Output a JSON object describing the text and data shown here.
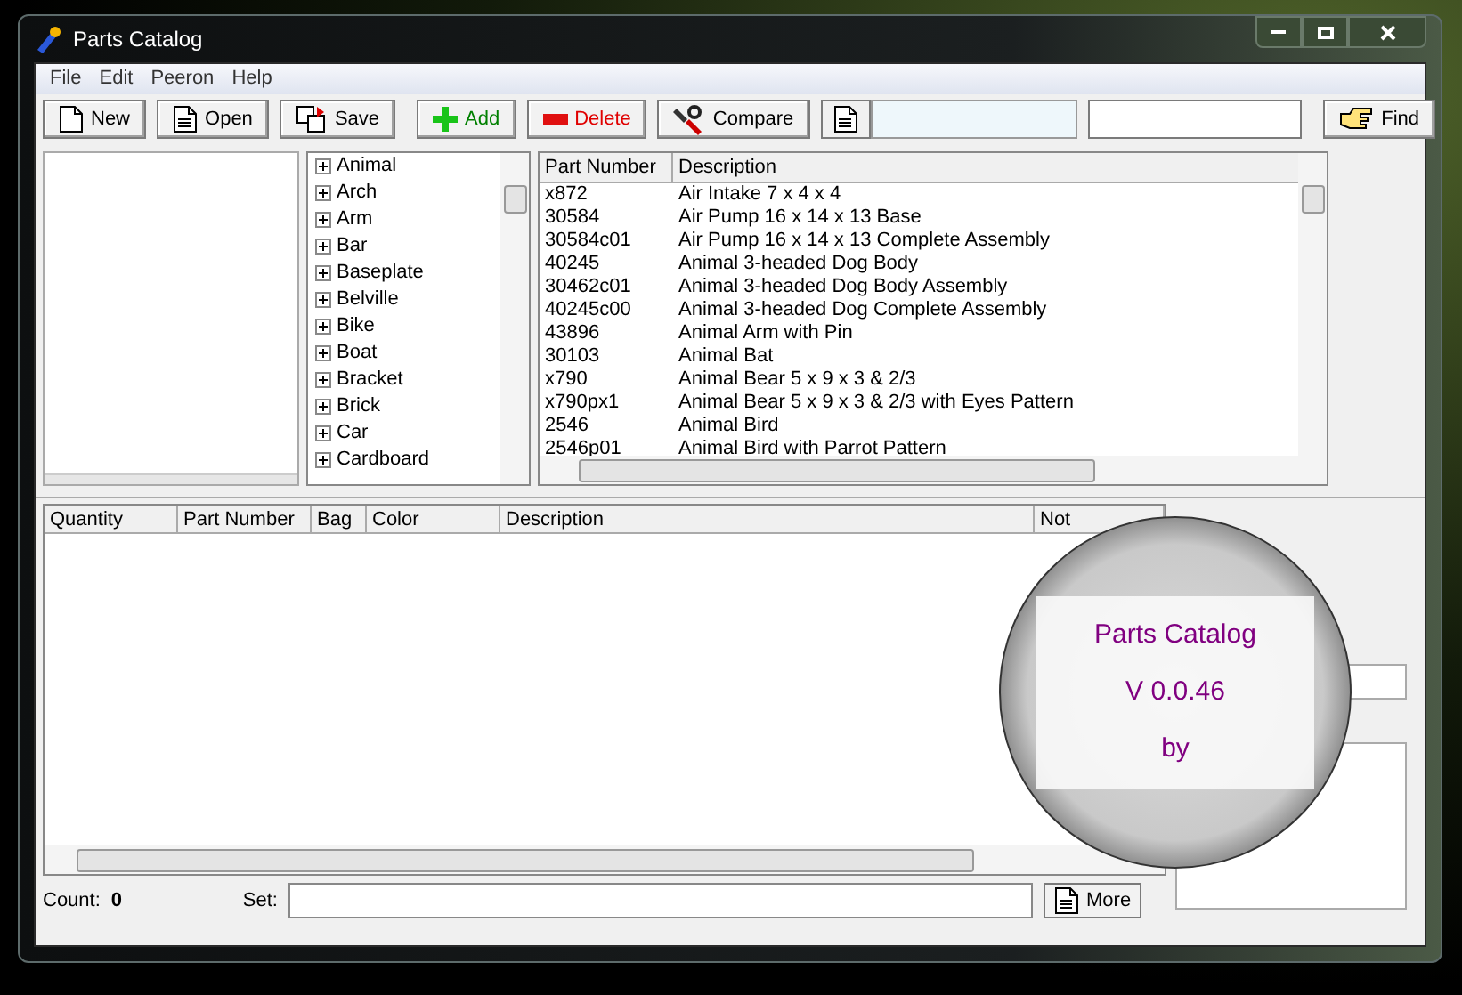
{
  "window": {
    "title": "Parts Catalog"
  },
  "menu": [
    "File",
    "Edit",
    "Peeron",
    "Help"
  ],
  "toolbar": [
    {
      "kind": "new",
      "label": "New"
    },
    {
      "kind": "open",
      "label": "Open"
    },
    {
      "kind": "save",
      "label": "Save"
    },
    {
      "kind": "add",
      "label": "Add"
    },
    {
      "kind": "delete",
      "label": "Delete"
    },
    {
      "kind": "compare",
      "label": "Compare"
    },
    {
      "kind": "print"
    },
    {
      "kind": "find",
      "label": "Find"
    }
  ],
  "categories": [
    "Animal",
    "Arch",
    "Arm",
    "Bar",
    "Baseplate",
    "Belville",
    "Bike",
    "Boat",
    "Bracket",
    "Brick",
    "Car",
    "Cardboard"
  ],
  "parts": {
    "columns": [
      "Part Number",
      "Description"
    ],
    "rows": [
      [
        "x872",
        "Air Intake 7 x 4 x 4"
      ],
      [
        "30584",
        "Air Pump 16 x 14 x 13 Base"
      ],
      [
        "30584c01",
        "Air Pump 16 x 14 x 13 Complete Assembly"
      ],
      [
        "40245",
        "Animal 3-headed Dog Body"
      ],
      [
        "30462c01",
        "Animal 3-headed Dog Body Assembly"
      ],
      [
        "40245c00",
        "Animal 3-headed Dog Complete Assembly"
      ],
      [
        "43896",
        "Animal Arm with Pin"
      ],
      [
        "30103",
        "Animal Bat"
      ],
      [
        "x790",
        "Animal Bear 5 x 9 x 3 & 2/3"
      ],
      [
        "x790px1",
        "Animal Bear 5 x 9 x 3 & 2/3 with Eyes Pattern"
      ],
      [
        "2546",
        "Animal Bird"
      ],
      [
        "2546p01",
        "Animal Bird with Parrot Pattern"
      ]
    ]
  },
  "set_table": {
    "columns": [
      "Quantity",
      "Part Number",
      "Bag",
      "Color",
      "Description",
      "Not"
    ]
  },
  "footer": {
    "count_label": "Count:",
    "count": "0",
    "set_label": "Set:",
    "more": "More"
  },
  "splash": {
    "title": "Parts Catalog",
    "version": "V 0.0.46",
    "by": "by"
  }
}
